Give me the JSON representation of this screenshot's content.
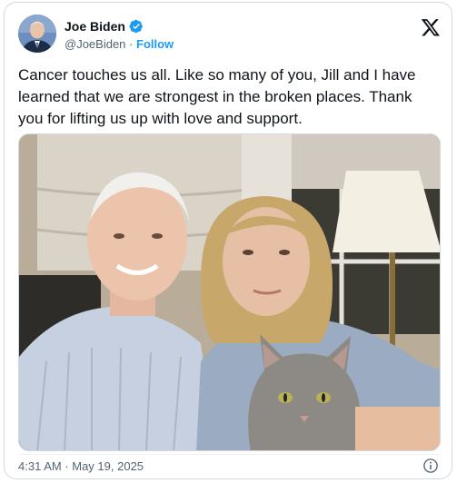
{
  "author": {
    "name": "Joe Biden",
    "handle": "@JoeBiden",
    "separator": "·",
    "follow_label": "Follow",
    "verified": true,
    "avatar_icon": "avatar-portrait"
  },
  "platform_logo": "x-logo-icon",
  "tweet": {
    "text": "Cancer touches us all. Like so many of you, Jill and I have learned that we are strongest in the broken places. Thank you for lifting us up with love and support.",
    "media_description_icon": "photo-image"
  },
  "footer": {
    "timestamp": "4:31 AM · May 19, 2025",
    "info_icon": "info-icon"
  },
  "colors": {
    "accent": "#1d9bf0",
    "text_primary": "#0f1419",
    "text_secondary": "#536471",
    "border": "#cfd9de"
  }
}
